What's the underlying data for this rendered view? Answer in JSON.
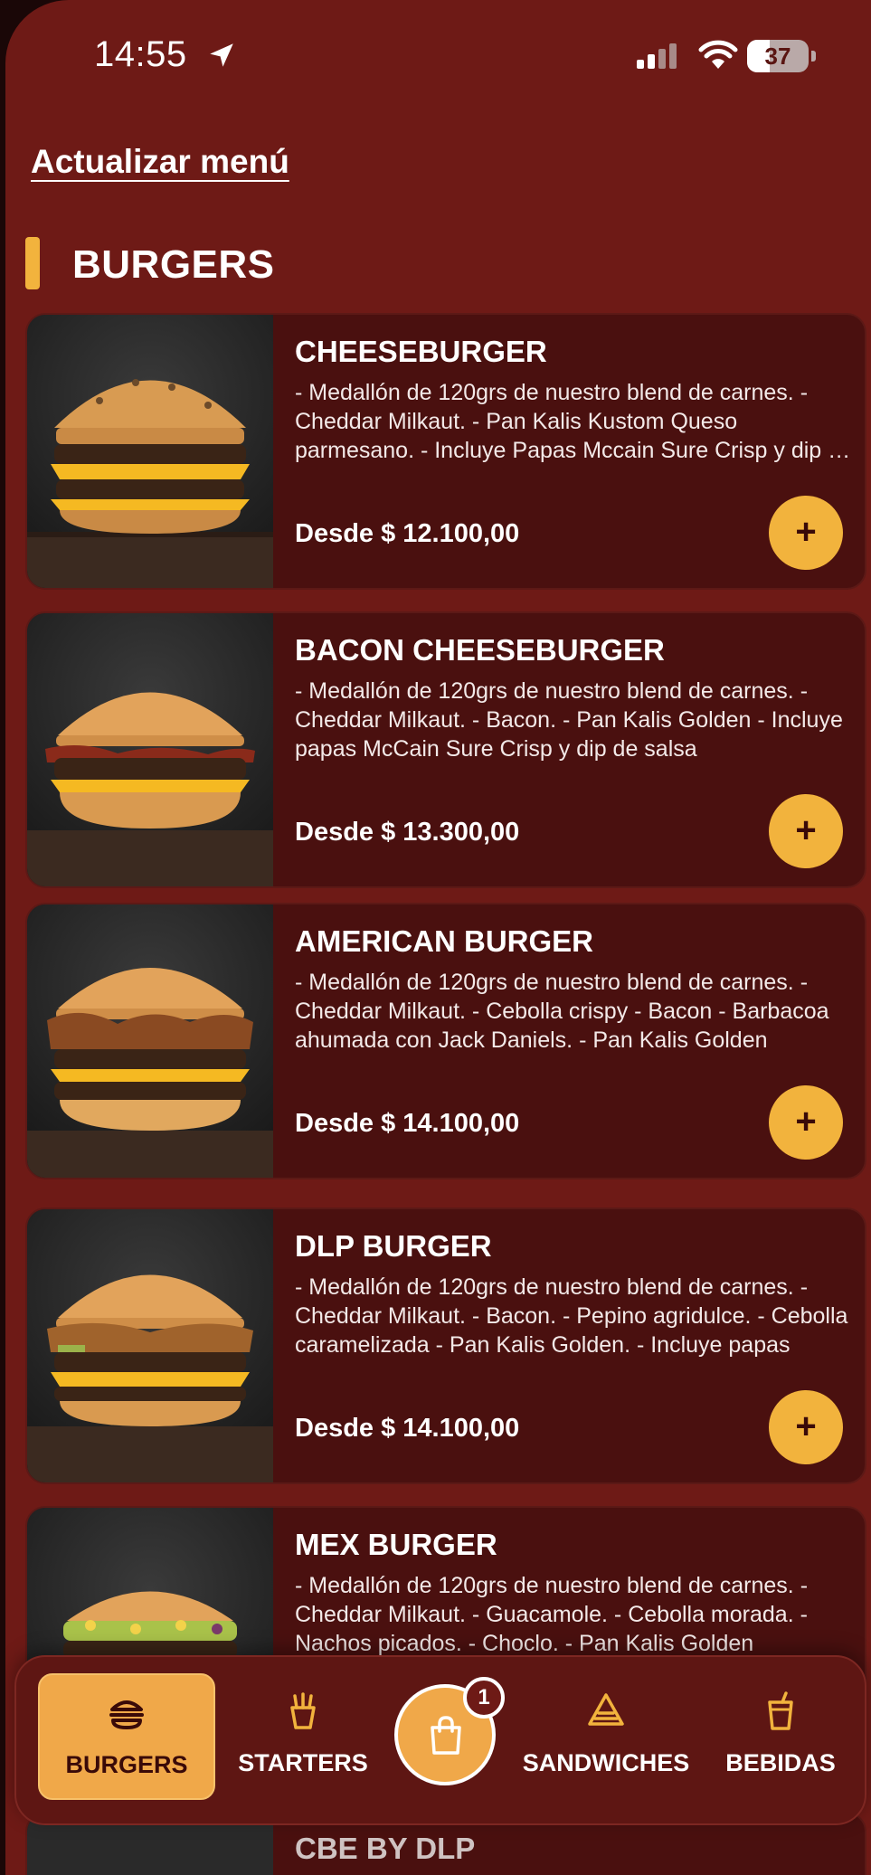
{
  "status_bar": {
    "time": "14:55",
    "battery_level": "37",
    "battery_fraction": 0.37,
    "icons": [
      "location-arrow-icon",
      "signal-icon",
      "wifi-icon",
      "battery-icon"
    ]
  },
  "refresh_link": "Actualizar menú",
  "section": {
    "title": "BURGERS",
    "accent": "#f2b33d"
  },
  "items": [
    {
      "name": "CHEESEBURGER",
      "description": "- Medallón de 120grs de nuestro blend de carnes. - Cheddar Milkaut. - Pan Kalis Kustom Queso parmesano. - Incluye Papas Mccain Sure Crisp y dip de salsa",
      "price": "Desde $ 12.100,00",
      "add_label": "+"
    },
    {
      "name": "BACON CHEESEBURGER",
      "description": "- Medallón de 120grs de nuestro blend de carnes. - Cheddar Milkaut. - Bacon. - Pan Kalis Golden - Incluye papas McCain Sure Crisp y dip de salsa",
      "price": "Desde $ 13.300,00",
      "add_label": "+"
    },
    {
      "name": "AMERICAN BURGER",
      "description": "- Medallón de 120grs de nuestro blend de carnes. - Cheddar Milkaut. - Cebolla crispy - Bacon - Barbacoa ahumada con Jack Daniels. - Pan Kalis Golden",
      "price": "Desde $ 14.100,00",
      "add_label": "+"
    },
    {
      "name": "DLP BURGER",
      "description": "- Medallón de 120grs de nuestro blend de carnes. - Cheddar Milkaut. - Bacon. - Pepino agridulce. - Cebolla caramelizada - Pan Kalis Golden. - Incluye papas",
      "price": "Desde $ 14.100,00",
      "add_label": "+"
    },
    {
      "name": "MEX BURGER",
      "description": "- Medallón de 120grs de nuestro blend de carnes. - Cheddar Milkaut. - Guacamole. - Cebolla morada. - Nachos picados. - Choclo. - Pan Kalis Golden",
      "price": "",
      "add_label": "+"
    }
  ],
  "peek_item": {
    "name": "CBE BY DLP"
  },
  "bottom_nav": {
    "items": [
      {
        "label": "BURGERS",
        "icon": "burger-icon",
        "active": true
      },
      {
        "label": "STARTERS",
        "icon": "fries-icon",
        "active": false
      },
      {
        "label": "SANDWICHES",
        "icon": "sandwich-icon",
        "active": false
      },
      {
        "label": "BEBIDAS",
        "icon": "drink-icon",
        "active": false
      }
    ],
    "cart": {
      "icon": "shopping-bag-icon",
      "count": "1"
    }
  },
  "colors": {
    "background": "#6e1a16",
    "card": "#4a100f",
    "accent": "#f2b33d",
    "nav_active": "#f0a849"
  }
}
